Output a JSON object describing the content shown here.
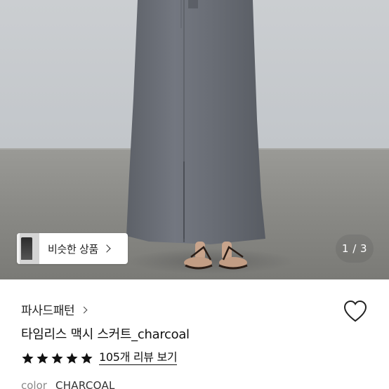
{
  "hero": {
    "similar_button_label": "비슷한 상품",
    "pager": "1 / 3"
  },
  "product": {
    "brand": "파사드패턴",
    "title": "타임리스 맥시 스커트_charcoal",
    "rating_stars": 5,
    "review_link": "105개 리뷰 보기",
    "color_key": "color",
    "color_value": "CHARCOAL"
  },
  "colors": {
    "star": "#111111",
    "wall": "#c6cacd",
    "floor": "#8a8a86",
    "skirt": "#6c7077"
  },
  "icons": {
    "wishlist": "heart-outline-icon",
    "star": "star-filled-icon",
    "chevron": "chevron-right-icon"
  }
}
